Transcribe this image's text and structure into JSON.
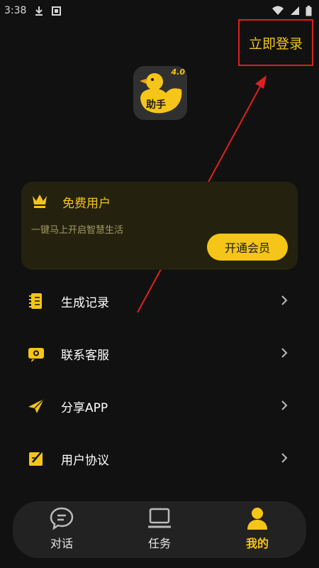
{
  "status_bar": {
    "time": "3:38"
  },
  "header": {
    "login_label": "立即登录"
  },
  "app": {
    "version": "4.0",
    "logo_text": "助手"
  },
  "vip_card": {
    "title": "免费用户",
    "subtitle": "一键马上开启智慧生活",
    "button_label": "开通会员"
  },
  "menu": {
    "items": [
      {
        "label": "生成记录",
        "icon": "notebook-icon"
      },
      {
        "label": "联系客服",
        "icon": "customer-service-icon"
      },
      {
        "label": "分享APP",
        "icon": "paper-plane-icon"
      },
      {
        "label": "用户协议",
        "icon": "agreement-icon"
      }
    ]
  },
  "bottom_nav": {
    "tabs": [
      {
        "label": "对话",
        "icon": "chat-bubble-icon",
        "active": false
      },
      {
        "label": "任务",
        "icon": "laptop-icon",
        "active": false
      },
      {
        "label": "我的",
        "icon": "user-icon",
        "active": true
      }
    ]
  },
  "colors": {
    "accent": "#f5c518",
    "background": "#111111",
    "card": "#24220f",
    "nav": "#222222",
    "annotation": "#e02020"
  }
}
